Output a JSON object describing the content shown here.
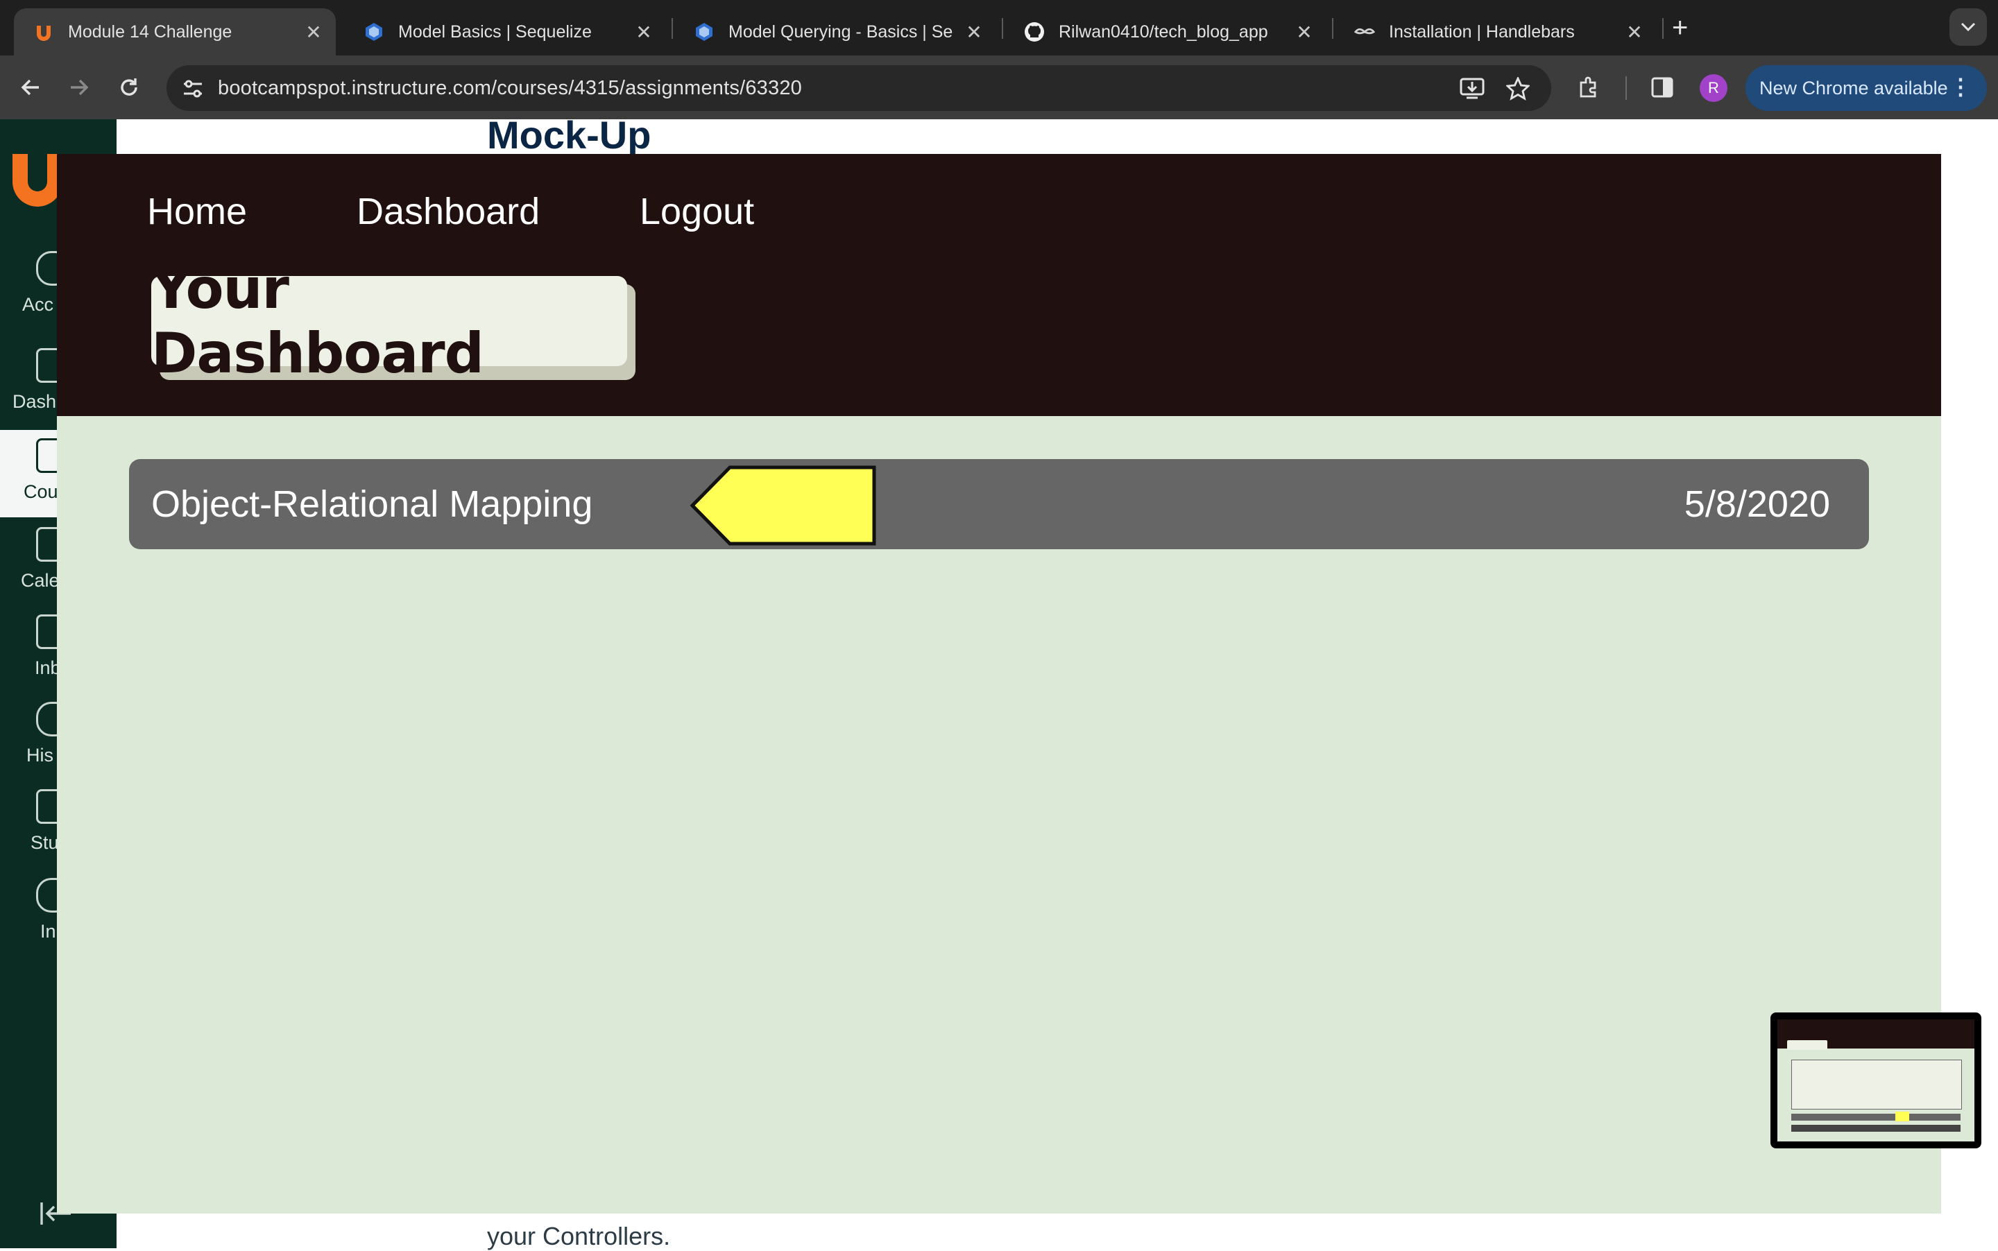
{
  "browser": {
    "tabs": [
      {
        "title": "Module 14 Challenge",
        "active": true,
        "favicon": "u-logo-icon"
      },
      {
        "title": "Model Basics | Sequelize",
        "active": false,
        "favicon": "sequelize-icon"
      },
      {
        "title": "Model Querying - Basics | Se",
        "active": false,
        "favicon": "sequelize-icon"
      },
      {
        "title": "Rilwan0410/tech_blog_app",
        "active": false,
        "favicon": "github-icon"
      },
      {
        "title": "Installation | Handlebars",
        "active": false,
        "favicon": "handlebars-icon"
      }
    ],
    "url": "bootcampspot.instructure.com/courses/4315/assignments/63320",
    "profile_initial": "R",
    "update_label": "New Chrome available"
  },
  "canvas": {
    "sidebar_items": [
      "Acc",
      "Dash",
      "Cou",
      "Cale",
      "Inb",
      "His",
      "Stu",
      "In"
    ],
    "heading": "Mock-Up",
    "body_text": "your Controllers."
  },
  "mockup": {
    "nav": [
      "Home",
      "Dashboard",
      "Logout"
    ],
    "title": "Your Dashboard",
    "post": {
      "title": "Object-Relational Mapping",
      "date": "5/8/2020"
    },
    "colors": {
      "header": "#201010",
      "body": "#dce9d6",
      "row": "#666666",
      "pointer": "#ffff55"
    }
  }
}
